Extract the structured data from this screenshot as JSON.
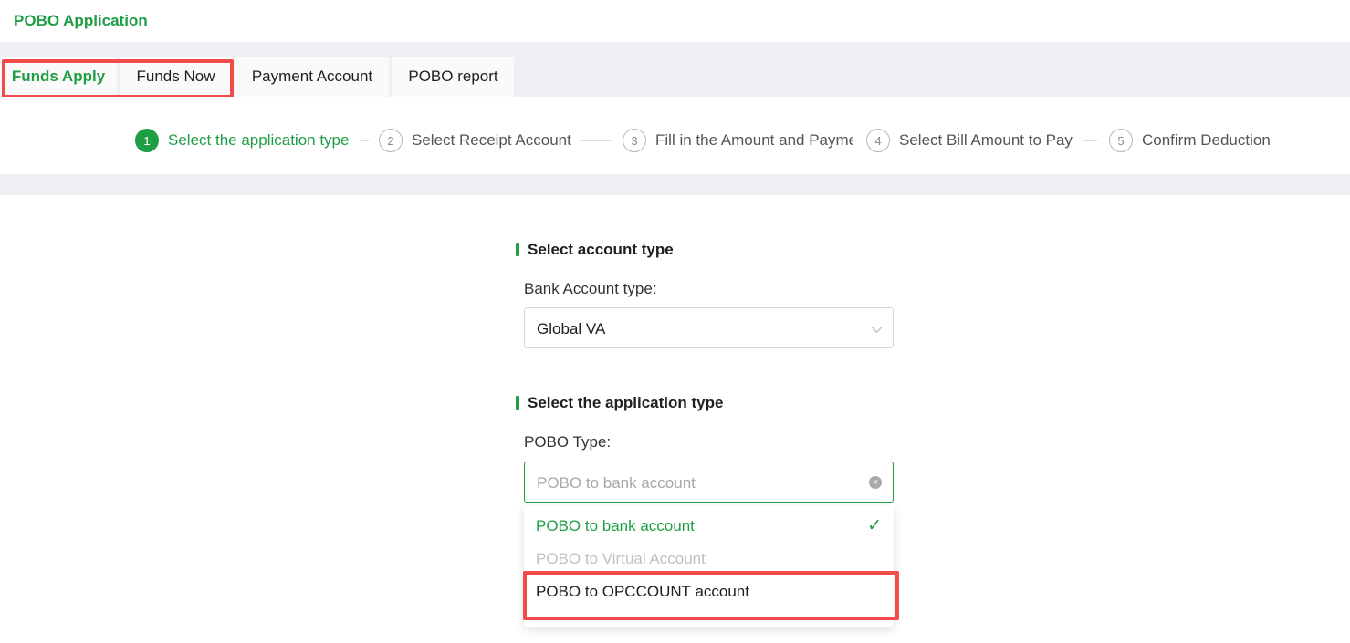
{
  "header": {
    "title": "POBO Application"
  },
  "tabs": [
    {
      "label": "Funds Apply",
      "active": true
    },
    {
      "label": "Funds Now",
      "active": false
    },
    {
      "label": "Payment Account",
      "active": false
    },
    {
      "label": "POBO report",
      "active": false
    }
  ],
  "steps": [
    {
      "num": "1",
      "label": "Select the application type",
      "active": true
    },
    {
      "num": "2",
      "label": "Select Receipt Account",
      "active": false
    },
    {
      "num": "3",
      "label": "Fill in the Amount and Payme",
      "active": false
    },
    {
      "num": "4",
      "label": "Select Bill Amount to Pay",
      "active": false
    },
    {
      "num": "5",
      "label": "Confirm Deduction",
      "active": false
    }
  ],
  "account_section": {
    "title": "Select account type",
    "label": "Bank Account type:",
    "value": "Global VA"
  },
  "application_section": {
    "title": "Select the application type",
    "label": "POBO Type:",
    "placeholder": "POBO to bank account",
    "options": [
      {
        "label": "POBO to bank account",
        "state": "selected",
        "check": "✓"
      },
      {
        "label": "POBO to Virtual Account",
        "state": "disabled"
      },
      {
        "label": "POBO to OPCCOUNT account",
        "state": "normal"
      }
    ]
  },
  "colors": {
    "accent": "#1f9e44",
    "highlight": "#f24b4b"
  }
}
